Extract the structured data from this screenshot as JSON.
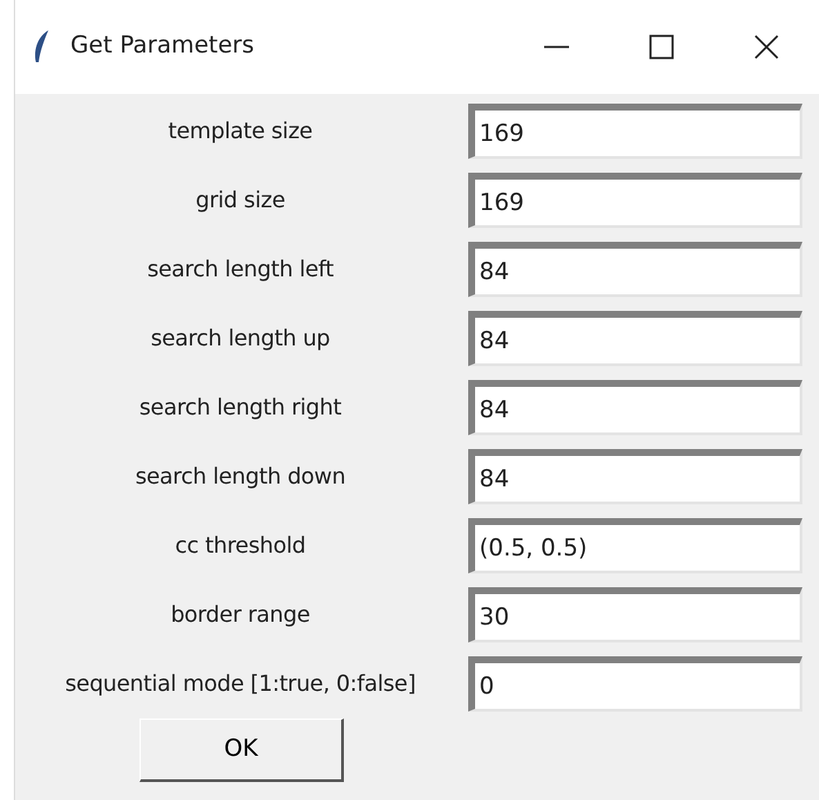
{
  "window": {
    "title": "Get Parameters"
  },
  "fields": [
    {
      "label": "template size",
      "value": "169"
    },
    {
      "label": "grid size",
      "value": "169"
    },
    {
      "label": "search length left",
      "value": "84"
    },
    {
      "label": "search length up",
      "value": "84"
    },
    {
      "label": "search length right",
      "value": "84"
    },
    {
      "label": "search length down",
      "value": "84"
    },
    {
      "label": "cc threshold",
      "value": "(0.5, 0.5)"
    },
    {
      "label": "border range",
      "value": "30"
    },
    {
      "label": "sequential mode [1:true, 0:false]",
      "value": "0"
    }
  ],
  "buttons": [
    "OK"
  ]
}
